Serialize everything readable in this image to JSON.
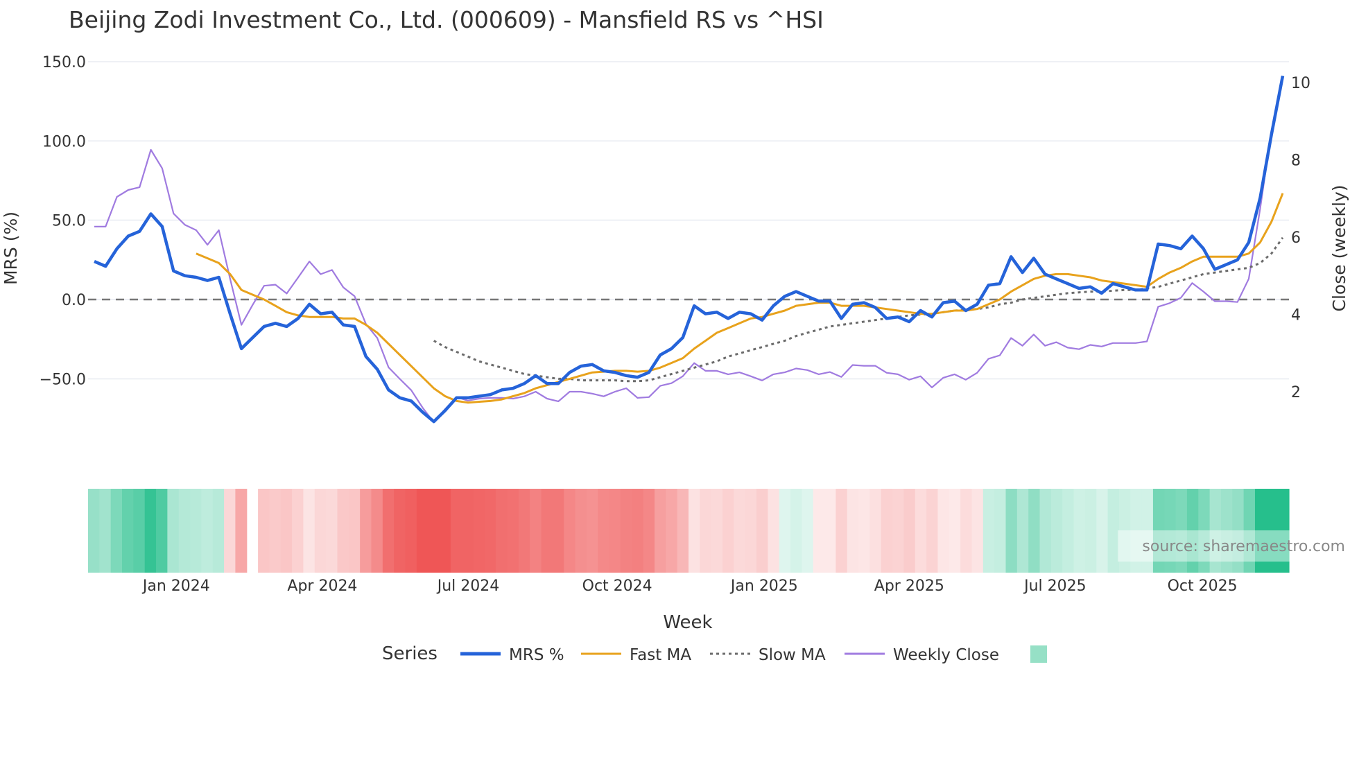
{
  "chart_data": {
    "type": "line",
    "title": "Beijing Zodi Investment Co., Ltd. (000609) - Mansfield RS vs ^HSI",
    "xlabel": "Week",
    "ylabel": "MRS (%)",
    "y2label": "Close (weekly)",
    "ylim": [
      -90,
      152
    ],
    "y2lim": [
      0.8,
      10.8
    ],
    "yticks": [
      -50,
      0,
      50,
      100,
      150
    ],
    "ytick_labels": [
      "−50.0",
      "0.0",
      "50.0",
      "100.0",
      "150.0"
    ],
    "y2ticks": [
      2,
      4,
      6,
      8,
      10
    ],
    "y2tick_labels": [
      "2",
      "4",
      "6",
      "8",
      "10"
    ],
    "xticks": [
      7.25,
      20.15,
      33.05,
      46.2,
      59.2,
      72.0,
      84.9,
      97.9
    ],
    "xtick_labels": [
      "Jan 2024",
      "Apr 2024",
      "Jul 2024",
      "Oct 2024",
      "Jan 2025",
      "Apr 2025",
      "Jul 2025",
      "Oct 2025"
    ],
    "zero_line": 0,
    "source": "source: sharemaestro.com",
    "legend": {
      "title": "Series",
      "placement": "bottom-center"
    },
    "series": [
      {
        "name": "MRS %",
        "color": "#2563d9",
        "axis": "left",
        "style": "solid",
        "start": 0,
        "values": [
          24,
          21,
          32,
          40,
          43,
          54,
          46,
          18,
          15,
          14,
          12,
          14,
          -9,
          -31,
          -24,
          -17,
          -15,
          -17,
          -12,
          -3,
          -9,
          -8,
          -16,
          -17,
          -36,
          -44,
          -57,
          -62,
          -64,
          -71,
          -77,
          -70,
          -62,
          -62,
          -61,
          -60,
          -57,
          -56,
          -53,
          -48,
          -53,
          -53,
          -46,
          -42,
          -41,
          -45,
          -46,
          -48,
          -49,
          -46,
          -35,
          -31,
          -24,
          -4,
          -9,
          -8,
          -12,
          -8,
          -9,
          -13,
          -4,
          2,
          5,
          2,
          -1,
          -1,
          -12,
          -3,
          -2,
          -5,
          -12,
          -11,
          -14,
          -7,
          -11,
          -2,
          -1,
          -7,
          -3,
          9,
          10,
          27,
          17,
          26,
          16,
          13,
          10,
          7,
          8,
          4,
          10,
          8,
          6,
          6,
          35,
          34,
          32,
          40,
          32,
          19,
          22,
          25,
          36,
          64,
          104,
          141
        ]
      },
      {
        "name": "Fast MA",
        "color": "#e8a21c",
        "axis": "left",
        "style": "solid",
        "start": 9,
        "values": [
          29,
          26,
          23,
          16,
          6,
          3,
          0,
          -4,
          -8,
          -10,
          -11,
          -11,
          -11,
          -12,
          -12,
          -16,
          -21,
          -28,
          -35,
          -42,
          -49,
          -56,
          -61,
          -64,
          -65,
          -64.5,
          -64,
          -63,
          -61,
          -59,
          -56,
          -54,
          -52,
          -50,
          -48,
          -46,
          -45.5,
          -45,
          -45,
          -45.5,
          -45,
          -43,
          -40,
          -37,
          -31,
          -26,
          -21,
          -18,
          -15,
          -12,
          -11,
          -9,
          -7,
          -4,
          -3,
          -2,
          -2,
          -4,
          -4,
          -4,
          -5,
          -6,
          -7,
          -8,
          -9,
          -9,
          -8,
          -7,
          -7,
          -6,
          -3,
          0,
          5,
          9,
          13,
          15,
          16,
          16,
          15,
          14,
          12,
          11,
          10,
          9,
          8,
          13,
          17,
          20,
          24,
          27,
          27,
          27,
          27,
          29,
          36,
          49,
          67
        ]
      },
      {
        "name": "Slow MA",
        "color": "#6b6b6b",
        "axis": "left",
        "style": "dot",
        "start": 30,
        "values": [
          -26,
          -30,
          -33,
          -36,
          -39,
          -41,
          -43,
          -45,
          -47,
          -48,
          -49,
          -50,
          -50,
          -51,
          -51,
          -51,
          -51,
          -51.5,
          -51.5,
          -51,
          -49,
          -47,
          -45,
          -43,
          -41,
          -39,
          -36,
          -34,
          -32,
          -30,
          -28,
          -26,
          -23,
          -21,
          -19,
          -17,
          -16,
          -15,
          -14,
          -13,
          -12,
          -11,
          -10,
          -9.5,
          -9,
          -8,
          -7,
          -6.5,
          -6,
          -5,
          -3,
          -2,
          0,
          1,
          2,
          3,
          4,
          4.5,
          5,
          5,
          5.5,
          6,
          6,
          7,
          8,
          10,
          12,
          14,
          16,
          17,
          18,
          19,
          20,
          23,
          29,
          39
        ]
      },
      {
        "name": "Weekly Close",
        "color": "#a07be0",
        "axis": "right",
        "style": "solid",
        "start": 0,
        "values": [
          6.27,
          6.27,
          7.04,
          7.22,
          7.29,
          8.26,
          7.78,
          6.61,
          6.32,
          6.18,
          5.8,
          6.18,
          4.92,
          3.73,
          4.25,
          4.74,
          4.77,
          4.54,
          4.95,
          5.37,
          5.04,
          5.15,
          4.7,
          4.47,
          3.75,
          3.39,
          2.63,
          2.33,
          2.04,
          1.59,
          1.21,
          1.55,
          1.86,
          1.77,
          1.82,
          1.84,
          1.84,
          1.82,
          1.88,
          2.0,
          1.82,
          1.75,
          2.0,
          2.0,
          1.95,
          1.88,
          2.0,
          2.09,
          1.84,
          1.86,
          2.15,
          2.22,
          2.4,
          2.74,
          2.54,
          2.54,
          2.45,
          2.5,
          2.4,
          2.29,
          2.45,
          2.5,
          2.6,
          2.56,
          2.45,
          2.51,
          2.38,
          2.69,
          2.67,
          2.67,
          2.49,
          2.45,
          2.31,
          2.4,
          2.11,
          2.36,
          2.45,
          2.31,
          2.49,
          2.85,
          2.94,
          3.39,
          3.19,
          3.48,
          3.19,
          3.28,
          3.14,
          3.1,
          3.21,
          3.17,
          3.26,
          3.26,
          3.26,
          3.3,
          4.2,
          4.29,
          4.43,
          4.81,
          4.59,
          4.34,
          4.34,
          4.32,
          4.92,
          6.73,
          8.75,
          10.1
        ]
      }
    ],
    "heatmap": {
      "name": "",
      "swatch_color": "#96e0c6",
      "positive_color": "#26bf8c",
      "negative_color": "#ef5656",
      "missing_index": 14
    }
  }
}
